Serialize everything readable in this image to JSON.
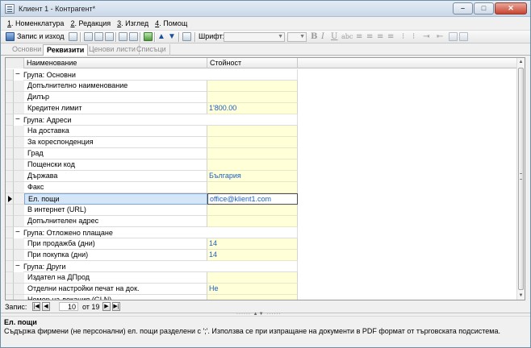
{
  "window": {
    "title": "Клиент 1 - Контрагент*",
    "buttons": {
      "minimize": "–",
      "maximize": "□",
      "close": "✕"
    }
  },
  "menu": [
    {
      "key": "1",
      "label": "Номенклатура"
    },
    {
      "key": "2",
      "label": "Редакция"
    },
    {
      "key": "3",
      "label": "Изглед"
    },
    {
      "key": "4",
      "label": "Помощ"
    }
  ],
  "toolbar": {
    "save_label": "Запис и изход",
    "font_label": "Шрифт:",
    "icons": [
      "save-icon",
      "copy-doc-icon",
      "cut-icon",
      "copy-icon",
      "paste-icon",
      "print-icon",
      "preview-icon",
      "refresh-icon",
      "arrow-up-icon",
      "arrow-down-icon",
      "help-icon",
      "bold-icon",
      "italic-icon",
      "underline-icon",
      "strikethrough-icon",
      "align-left-icon",
      "align-center-icon",
      "align-right-icon",
      "justify-icon",
      "bullets-icon",
      "numbering-icon",
      "indent-icon",
      "outdent-icon",
      "insert-icon",
      "image-icon"
    ]
  },
  "tabs": [
    {
      "label": "Основни",
      "active": false
    },
    {
      "label": "Реквизити",
      "active": true
    },
    {
      "label": "Ценови листи",
      "active": false
    },
    {
      "label": "Списъци",
      "active": false
    }
  ],
  "grid": {
    "columns": [
      "Наименование",
      "Стойност"
    ],
    "rows": [
      {
        "type": "group",
        "label": "Група: Основни"
      },
      {
        "type": "item",
        "name": "Допълнително наименование",
        "value": ""
      },
      {
        "type": "item",
        "name": "Дилър",
        "value": ""
      },
      {
        "type": "item",
        "name": "Кредитен лимит",
        "value": "1'800.00"
      },
      {
        "type": "group",
        "label": "Група: Адреси"
      },
      {
        "type": "item",
        "name": "На доставка",
        "value": ""
      },
      {
        "type": "item",
        "name": "За кореспонденция",
        "value": ""
      },
      {
        "type": "item",
        "name": "Град",
        "value": ""
      },
      {
        "type": "item",
        "name": "Пощенски код",
        "value": ""
      },
      {
        "type": "item",
        "name": "Държава",
        "value": "България"
      },
      {
        "type": "item",
        "name": "Факс",
        "value": ""
      },
      {
        "type": "item",
        "name": "Ел. пощи",
        "value": "office@klient1.com",
        "selected": true
      },
      {
        "type": "item",
        "name": "В интернет (URL)",
        "value": ""
      },
      {
        "type": "item",
        "name": "Допълнителен адрес",
        "value": ""
      },
      {
        "type": "group",
        "label": "Група: Отложено плащане"
      },
      {
        "type": "item",
        "name": "При продажба (дни)",
        "value": "14"
      },
      {
        "type": "item",
        "name": "При покупка (дни)",
        "value": "14"
      },
      {
        "type": "group",
        "label": "Група: Други"
      },
      {
        "type": "item",
        "name": "Издател на ДПрод",
        "value": ""
      },
      {
        "type": "item",
        "name": "Отделни настройки печат на док.",
        "value": "Не"
      },
      {
        "type": "item",
        "name": "Номер на локация (GLN)",
        "value": ""
      }
    ]
  },
  "navigator": {
    "label": "Запис:",
    "current": "10",
    "of_label": "от 19"
  },
  "description": {
    "title": "Ел. пощи",
    "text": "Съдържа фирмени (не персонални) ел. пощи разделени с ';'. Използва се при изпращане на документи в PDF формат от търговската подсистема."
  }
}
